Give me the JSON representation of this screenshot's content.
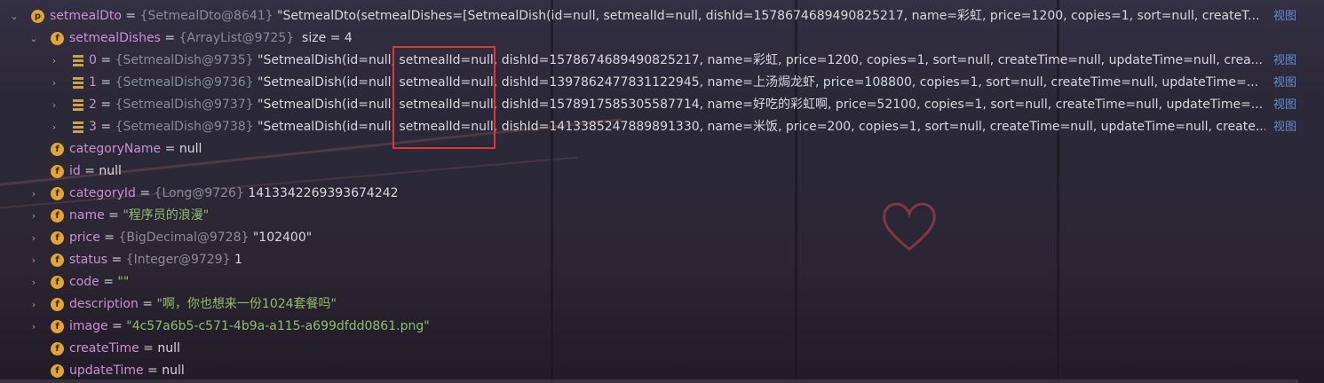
{
  "root": {
    "name": "setmealDto",
    "badge": "p",
    "ref": "{SetmealDto@8641}",
    "value": "\"SetmealDto(setmealDishes=[SetmealDish(id=null, setmealId=null, dishId=1578674689490825217, name=彩虹, price=1200, copies=1, sort=null, createT...",
    "view": "视图"
  },
  "setmealDishes": {
    "name": "setmealDishes",
    "badge": "f",
    "ref": "{ArrayList@9725}",
    "size": "size = 4"
  },
  "items": [
    {
      "index": "0",
      "ref": "{SetmealDish@9735}",
      "prefix": "\"SetmealDish(id=null, ",
      "highlight": "setmealId=null,",
      "rest": " dishId=1578674689490825217, name=彩虹, price=1200, copies=1, sort=null, createTime=null, updateTime=null, crea...",
      "view": "视图"
    },
    {
      "index": "1",
      "ref": "{SetmealDish@9736}",
      "prefix": "\"SetmealDish(id=null, ",
      "highlight": "setmealId=null,",
      "rest": " dishId=1397862477831122945, name=上汤焗龙虾, price=108800, copies=1, sort=null, createTime=null, updateTime=...",
      "view": "视图"
    },
    {
      "index": "2",
      "ref": "{SetmealDish@9737}",
      "prefix": "\"SetmealDish(id=null, ",
      "highlight": "setmealId=null,",
      "rest": " dishId=1578917585305587714, name=好吃的彩虹啊, price=52100, copies=1, sort=null, createTime=null, updateTime=...",
      "view": "视图"
    },
    {
      "index": "3",
      "ref": "{SetmealDish@9738}",
      "prefix": "\"SetmealDish(id=null, ",
      "highlight": "setmealId=null,",
      "rest": " dishId=1413385247889891330, name=米饭, price=200, copies=1, sort=null, createTime=null, updateTime=null, create...",
      "view": "视图"
    }
  ],
  "fields": [
    {
      "name": "categoryName",
      "expandable": false,
      "ref": "",
      "value": "null",
      "kind": "val"
    },
    {
      "name": "id",
      "expandable": false,
      "ref": "",
      "value": "null",
      "kind": "val"
    },
    {
      "name": "categoryId",
      "expandable": true,
      "ref": "{Long@9726}",
      "value": "1413342269393674242",
      "kind": "val"
    },
    {
      "name": "name",
      "expandable": true,
      "ref": "",
      "value": "\"程序员的浪漫\"",
      "kind": "str"
    },
    {
      "name": "price",
      "expandable": true,
      "ref": "{BigDecimal@9728}",
      "value": "\"102400\"",
      "kind": "val"
    },
    {
      "name": "status",
      "expandable": true,
      "ref": "{Integer@9729}",
      "value": "1",
      "kind": "val"
    },
    {
      "name": "code",
      "expandable": true,
      "ref": "",
      "value": "\"\"",
      "kind": "str"
    },
    {
      "name": "description",
      "expandable": true,
      "ref": "",
      "value": "\"啊，你也想来一份1024套餐吗\"",
      "kind": "str"
    },
    {
      "name": "image",
      "expandable": true,
      "ref": "",
      "value": "\"4c57a6b5-c571-4b9a-a115-a699dfdd0861.png\"",
      "kind": "str"
    },
    {
      "name": "createTime",
      "expandable": false,
      "ref": "",
      "value": "null",
      "kind": "val"
    },
    {
      "name": "updateTime",
      "expandable": false,
      "ref": "",
      "value": "null",
      "kind": "val"
    }
  ],
  "field_badge": "f",
  "equals": " = ",
  "icons": {
    "expand": "chevron-down-icon",
    "collapse": "chevron-right-icon",
    "list": "list-icon"
  },
  "colors": {
    "highlight_box": "#e0333a",
    "badge": "#e4a530",
    "string": "#8fbf6a",
    "name": "#cc8fd4",
    "link": "#5f8ecf"
  }
}
